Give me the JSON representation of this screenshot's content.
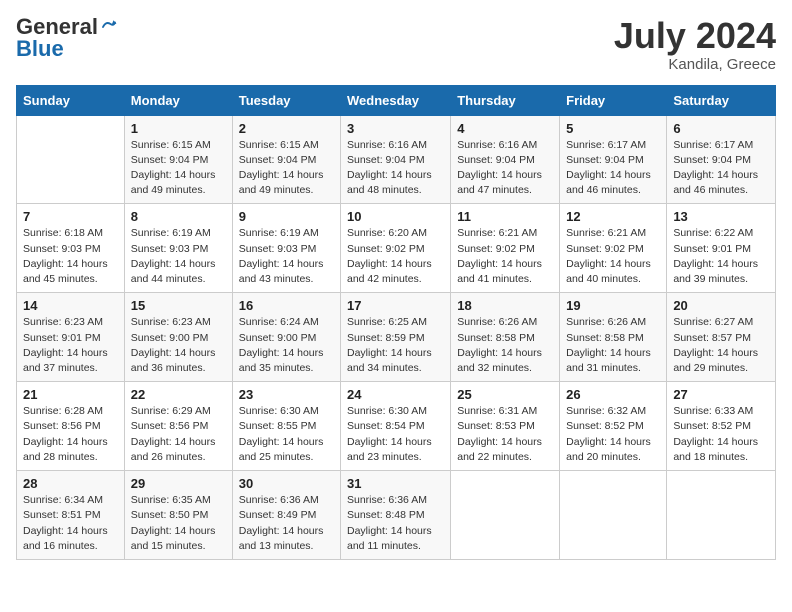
{
  "logo": {
    "general": "General",
    "blue": "Blue"
  },
  "title": {
    "month_year": "July 2024",
    "location": "Kandila, Greece"
  },
  "weekdays": [
    "Sunday",
    "Monday",
    "Tuesday",
    "Wednesday",
    "Thursday",
    "Friday",
    "Saturday"
  ],
  "weeks": [
    [
      {
        "day": "",
        "info": ""
      },
      {
        "day": "1",
        "info": "Sunrise: 6:15 AM\nSunset: 9:04 PM\nDaylight: 14 hours\nand 49 minutes."
      },
      {
        "day": "2",
        "info": "Sunrise: 6:15 AM\nSunset: 9:04 PM\nDaylight: 14 hours\nand 49 minutes."
      },
      {
        "day": "3",
        "info": "Sunrise: 6:16 AM\nSunset: 9:04 PM\nDaylight: 14 hours\nand 48 minutes."
      },
      {
        "day": "4",
        "info": "Sunrise: 6:16 AM\nSunset: 9:04 PM\nDaylight: 14 hours\nand 47 minutes."
      },
      {
        "day": "5",
        "info": "Sunrise: 6:17 AM\nSunset: 9:04 PM\nDaylight: 14 hours\nand 46 minutes."
      },
      {
        "day": "6",
        "info": "Sunrise: 6:17 AM\nSunset: 9:04 PM\nDaylight: 14 hours\nand 46 minutes."
      }
    ],
    [
      {
        "day": "7",
        "info": "Sunrise: 6:18 AM\nSunset: 9:03 PM\nDaylight: 14 hours\nand 45 minutes."
      },
      {
        "day": "8",
        "info": "Sunrise: 6:19 AM\nSunset: 9:03 PM\nDaylight: 14 hours\nand 44 minutes."
      },
      {
        "day": "9",
        "info": "Sunrise: 6:19 AM\nSunset: 9:03 PM\nDaylight: 14 hours\nand 43 minutes."
      },
      {
        "day": "10",
        "info": "Sunrise: 6:20 AM\nSunset: 9:02 PM\nDaylight: 14 hours\nand 42 minutes."
      },
      {
        "day": "11",
        "info": "Sunrise: 6:21 AM\nSunset: 9:02 PM\nDaylight: 14 hours\nand 41 minutes."
      },
      {
        "day": "12",
        "info": "Sunrise: 6:21 AM\nSunset: 9:02 PM\nDaylight: 14 hours\nand 40 minutes."
      },
      {
        "day": "13",
        "info": "Sunrise: 6:22 AM\nSunset: 9:01 PM\nDaylight: 14 hours\nand 39 minutes."
      }
    ],
    [
      {
        "day": "14",
        "info": "Sunrise: 6:23 AM\nSunset: 9:01 PM\nDaylight: 14 hours\nand 37 minutes."
      },
      {
        "day": "15",
        "info": "Sunrise: 6:23 AM\nSunset: 9:00 PM\nDaylight: 14 hours\nand 36 minutes."
      },
      {
        "day": "16",
        "info": "Sunrise: 6:24 AM\nSunset: 9:00 PM\nDaylight: 14 hours\nand 35 minutes."
      },
      {
        "day": "17",
        "info": "Sunrise: 6:25 AM\nSunset: 8:59 PM\nDaylight: 14 hours\nand 34 minutes."
      },
      {
        "day": "18",
        "info": "Sunrise: 6:26 AM\nSunset: 8:58 PM\nDaylight: 14 hours\nand 32 minutes."
      },
      {
        "day": "19",
        "info": "Sunrise: 6:26 AM\nSunset: 8:58 PM\nDaylight: 14 hours\nand 31 minutes."
      },
      {
        "day": "20",
        "info": "Sunrise: 6:27 AM\nSunset: 8:57 PM\nDaylight: 14 hours\nand 29 minutes."
      }
    ],
    [
      {
        "day": "21",
        "info": "Sunrise: 6:28 AM\nSunset: 8:56 PM\nDaylight: 14 hours\nand 28 minutes."
      },
      {
        "day": "22",
        "info": "Sunrise: 6:29 AM\nSunset: 8:56 PM\nDaylight: 14 hours\nand 26 minutes."
      },
      {
        "day": "23",
        "info": "Sunrise: 6:30 AM\nSunset: 8:55 PM\nDaylight: 14 hours\nand 25 minutes."
      },
      {
        "day": "24",
        "info": "Sunrise: 6:30 AM\nSunset: 8:54 PM\nDaylight: 14 hours\nand 23 minutes."
      },
      {
        "day": "25",
        "info": "Sunrise: 6:31 AM\nSunset: 8:53 PM\nDaylight: 14 hours\nand 22 minutes."
      },
      {
        "day": "26",
        "info": "Sunrise: 6:32 AM\nSunset: 8:52 PM\nDaylight: 14 hours\nand 20 minutes."
      },
      {
        "day": "27",
        "info": "Sunrise: 6:33 AM\nSunset: 8:52 PM\nDaylight: 14 hours\nand 18 minutes."
      }
    ],
    [
      {
        "day": "28",
        "info": "Sunrise: 6:34 AM\nSunset: 8:51 PM\nDaylight: 14 hours\nand 16 minutes."
      },
      {
        "day": "29",
        "info": "Sunrise: 6:35 AM\nSunset: 8:50 PM\nDaylight: 14 hours\nand 15 minutes."
      },
      {
        "day": "30",
        "info": "Sunrise: 6:36 AM\nSunset: 8:49 PM\nDaylight: 14 hours\nand 13 minutes."
      },
      {
        "day": "31",
        "info": "Sunrise: 6:36 AM\nSunset: 8:48 PM\nDaylight: 14 hours\nand 11 minutes."
      },
      {
        "day": "",
        "info": ""
      },
      {
        "day": "",
        "info": ""
      },
      {
        "day": "",
        "info": ""
      }
    ]
  ]
}
